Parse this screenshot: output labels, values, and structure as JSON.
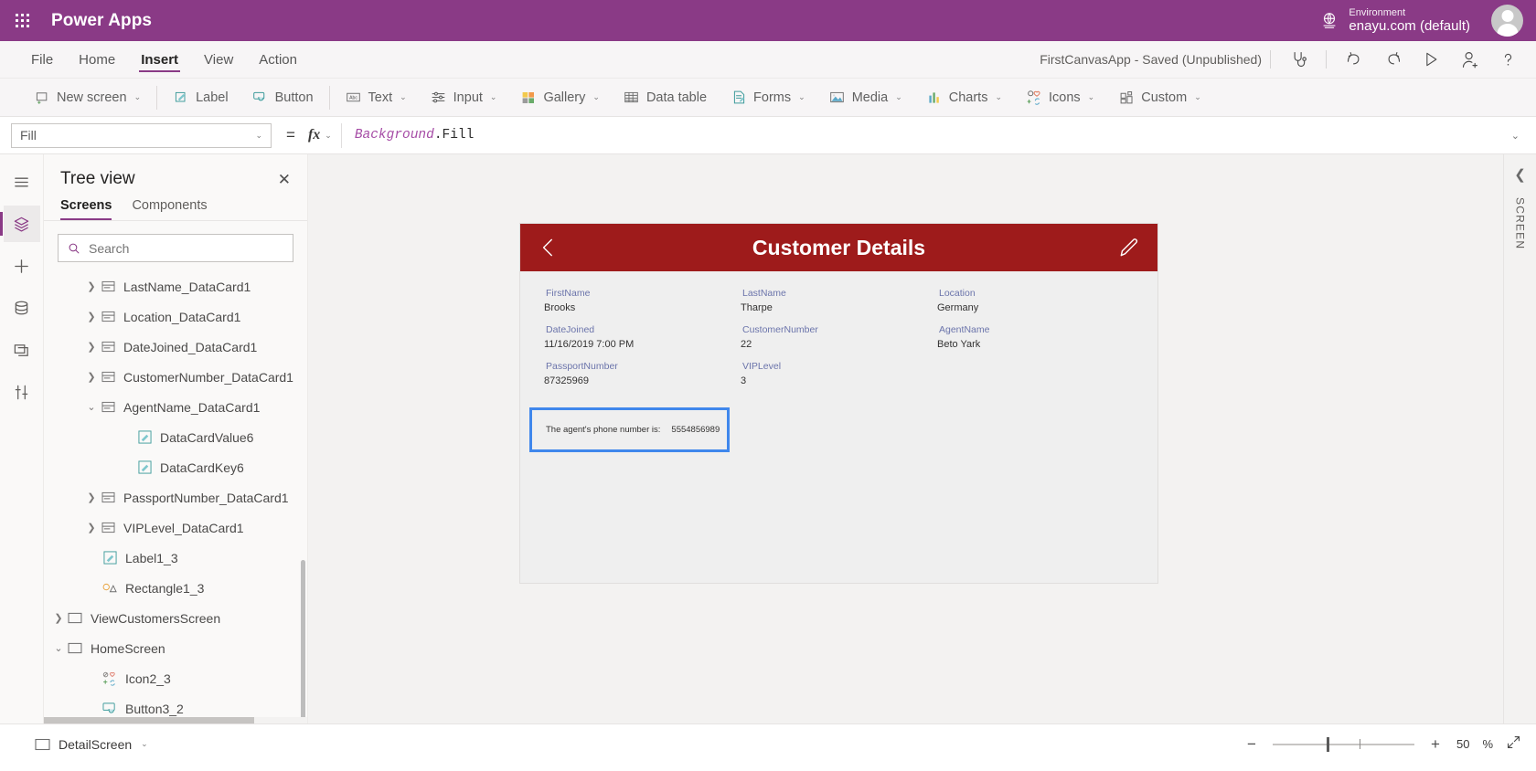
{
  "topbar": {
    "waffle_icon": "app-launcher-icon",
    "brand": "Power Apps",
    "environment_label": "Environment",
    "environment_name": "enayu.com (default)",
    "globe_icon": "environment-globe-icon",
    "avatar_icon": "user-avatar"
  },
  "menubar": {
    "items": [
      {
        "label": "File",
        "active": false
      },
      {
        "label": "Home",
        "active": false
      },
      {
        "label": "Insert",
        "active": true
      },
      {
        "label": "View",
        "active": false
      },
      {
        "label": "Action",
        "active": false
      }
    ],
    "saved_state": "FirstCanvasApp - Saved (Unpublished)",
    "tools": [
      {
        "name": "app-checker-icon",
        "glyph": "stethoscope"
      },
      {
        "name": "undo-icon",
        "glyph": "undo"
      },
      {
        "name": "redo-icon",
        "glyph": "redo"
      },
      {
        "name": "preview-play-icon",
        "glyph": "play"
      },
      {
        "name": "share-user-icon",
        "glyph": "share"
      },
      {
        "name": "help-icon",
        "glyph": "help"
      }
    ]
  },
  "ribbon": {
    "items": [
      {
        "label": "New screen",
        "icon": "new-screen-icon",
        "caret": true
      },
      {
        "label": "Label",
        "icon": "label-icon",
        "caret": false
      },
      {
        "label": "Button",
        "icon": "button-icon",
        "caret": false
      },
      {
        "label": "Text",
        "icon": "text-icon",
        "caret": true
      },
      {
        "label": "Input",
        "icon": "input-icon",
        "caret": true
      },
      {
        "label": "Gallery",
        "icon": "gallery-icon",
        "caret": true
      },
      {
        "label": "Data table",
        "icon": "data-table-icon",
        "caret": false
      },
      {
        "label": "Forms",
        "icon": "forms-icon",
        "caret": true
      },
      {
        "label": "Media",
        "icon": "media-icon",
        "caret": true
      },
      {
        "label": "Charts",
        "icon": "charts-icon",
        "caret": true
      },
      {
        "label": "Icons",
        "icon": "icons-icon",
        "caret": true
      },
      {
        "label": "Custom",
        "icon": "custom-icon",
        "caret": true
      }
    ]
  },
  "formulabar": {
    "property": "Fill",
    "equals": "=",
    "fx": "fx",
    "formula_ident": "Background",
    "formula_rest": ".Fill"
  },
  "rail": {
    "items": [
      {
        "name": "hamburger-menu-icon"
      },
      {
        "name": "tree-view-layers-icon",
        "active": true
      },
      {
        "name": "insert-plus-icon"
      },
      {
        "name": "data-cylinder-icon"
      },
      {
        "name": "media-folder-icon"
      },
      {
        "name": "advanced-tools-icon"
      }
    ]
  },
  "treeview": {
    "title": "Tree view",
    "close_icon": "close-icon",
    "tabs": [
      {
        "label": "Screens",
        "active": true
      },
      {
        "label": "Components",
        "active": false
      }
    ],
    "search_placeholder": "Search",
    "search_value": "",
    "search_icon": "search-icon",
    "nodes": [
      {
        "label": "LastName_DataCard1",
        "indent": 2,
        "chevron": "right",
        "icon": "data-card-icon"
      },
      {
        "label": "Location_DataCard1",
        "indent": 2,
        "chevron": "right",
        "icon": "data-card-icon"
      },
      {
        "label": "DateJoined_DataCard1",
        "indent": 2,
        "chevron": "right",
        "icon": "data-card-icon"
      },
      {
        "label": "CustomerNumber_DataCard1",
        "indent": 2,
        "chevron": "right",
        "icon": "data-card-icon"
      },
      {
        "label": "AgentName_DataCard1",
        "indent": 2,
        "chevron": "down",
        "icon": "data-card-icon"
      },
      {
        "label": "DataCardValue6",
        "indent": 3,
        "chevron": "none",
        "icon": "label-control-icon"
      },
      {
        "label": "DataCardKey6",
        "indent": 3,
        "chevron": "none",
        "icon": "label-control-icon"
      },
      {
        "label": "PassportNumber_DataCard1",
        "indent": 2,
        "chevron": "right",
        "icon": "data-card-icon"
      },
      {
        "label": "VIPLevel_DataCard1",
        "indent": 2,
        "chevron": "right",
        "icon": "data-card-icon"
      },
      {
        "label": "Label1_3",
        "indent": 2,
        "chevron": "none",
        "icon": "label-control-icon"
      },
      {
        "label": "Rectangle1_3",
        "indent": 2,
        "chevron": "none",
        "icon": "shape-icon"
      },
      {
        "label": "ViewCustomersScreen",
        "indent": 1,
        "chevron": "right",
        "icon": "screen-icon"
      },
      {
        "label": "HomeScreen",
        "indent": 1,
        "chevron": "down",
        "icon": "screen-icon"
      },
      {
        "label": "Icon2_3",
        "indent": 2,
        "chevron": "none",
        "icon": "icons-icon"
      },
      {
        "label": "Button3_2",
        "indent": 2,
        "chevron": "none",
        "icon": "button-control-icon"
      }
    ]
  },
  "canvas": {
    "app": {
      "header": {
        "back_icon": "back-chevron-icon",
        "title": "Customer Details",
        "edit_icon": "edit-pencil-icon",
        "background_color": "#9e1b1b"
      },
      "fields": [
        {
          "label": "FirstName",
          "value": "Brooks"
        },
        {
          "label": "LastName",
          "value": "Tharpe"
        },
        {
          "label": "Location",
          "value": "Germany"
        },
        {
          "label": "DateJoined",
          "value": "11/16/2019 7:00 PM"
        },
        {
          "label": "CustomerNumber",
          "value": "22"
        },
        {
          "label": "AgentName",
          "value": "Beto Yark"
        },
        {
          "label": "PassportNumber",
          "value": "87325969"
        },
        {
          "label": "VIPLevel",
          "value": "3"
        },
        {
          "label": "",
          "value": ""
        }
      ],
      "selected_label": {
        "text": "The agent's phone number is:",
        "number": "5554856989",
        "selection_color": "#3f87ec"
      }
    },
    "right_rail": {
      "collapse_icon": "collapse-chevron-icon",
      "text": "SCREEN"
    }
  },
  "statusbar": {
    "screen_icon": "screen-icon",
    "screen_name": "DetailScreen",
    "screen_caret": "chevron-down-icon",
    "zoom_out_icon": "zoom-out-minus-icon",
    "zoom_in_icon": "zoom-in-plus-icon",
    "zoom_value": "50",
    "zoom_unit": "%",
    "fullscreen_icon": "fit-to-screen-icon"
  }
}
